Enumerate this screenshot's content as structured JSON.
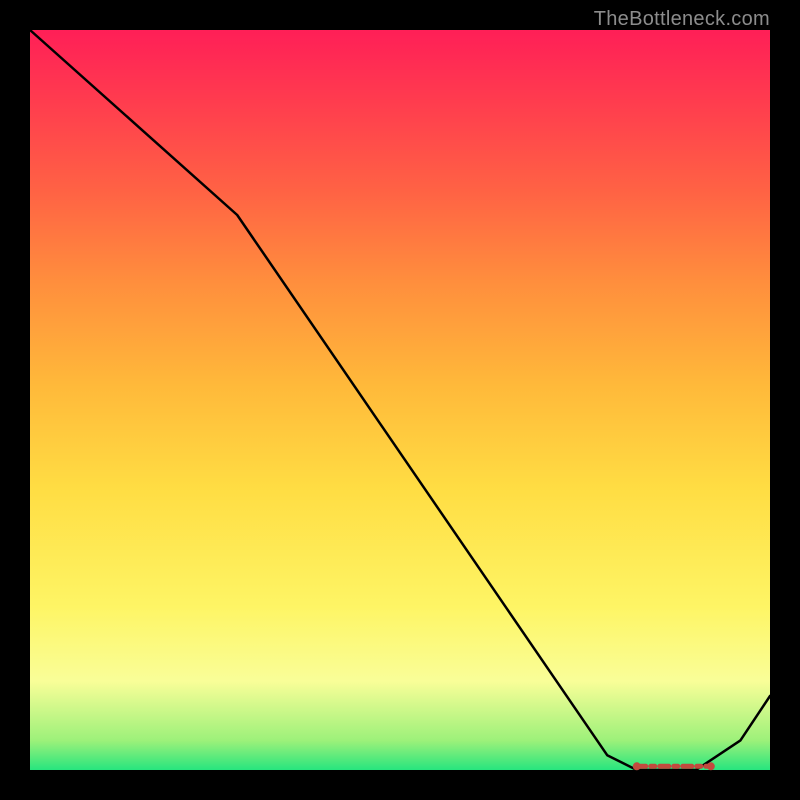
{
  "attribution": "TheBottleneck.com",
  "chart_data": {
    "type": "line",
    "title": "",
    "xlabel": "",
    "ylabel": "",
    "xlim": [
      0,
      100
    ],
    "ylim": [
      0,
      100
    ],
    "grid": false,
    "series": [
      {
        "name": "curve",
        "x": [
          0,
          28,
          78,
          82,
          90,
          96,
          100
        ],
        "values": [
          100,
          75,
          2,
          0,
          0,
          4,
          10
        ]
      }
    ],
    "highlight_region": {
      "name": "flat-minimum",
      "x_start": 82,
      "x_end": 92,
      "y": 0.5,
      "color": "#c24a3e"
    }
  },
  "colors": {
    "frame": "#000000",
    "line": "#000000",
    "hot": "#ff1f57",
    "cold": "#27e57e",
    "highlight": "#c24a3e",
    "attribution": "#8c8c8c"
  }
}
